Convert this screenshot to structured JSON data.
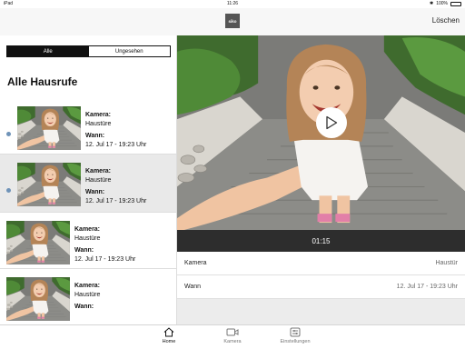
{
  "status_bar": {
    "device": "iPad",
    "time": "11:26",
    "battery": "100%"
  },
  "nav": {
    "logo_text": "siko",
    "delete_label": "Löschen"
  },
  "filter": {
    "all_label": "Alle",
    "unseen_label": "Ungesehen",
    "selected": "Alle"
  },
  "section_title": "Alle Hausrufe",
  "history_items": [
    {
      "camera_label": "Kamera:",
      "camera_value": "Haustüre",
      "when_label": "Wann:",
      "when_value": "12. Jul 17 - 19:23 Uhr",
      "unseen": true,
      "selected": false
    },
    {
      "camera_label": "Kamera:",
      "camera_value": "Haustüre",
      "when_label": "Wann:",
      "when_value": "12. Jul 17 - 19:23 Uhr",
      "unseen": true,
      "selected": true
    },
    {
      "camera_label": "Kamera:",
      "camera_value": "Haustüre",
      "when_label": "Wann:",
      "when_value": "12. Jul 17 - 19:23 Uhr",
      "unseen": false,
      "selected": false
    },
    {
      "camera_label": "Kamera:",
      "camera_value": "Haustüre",
      "when_label": "Wann:",
      "when_value": "",
      "unseen": false,
      "selected": false
    }
  ],
  "player": {
    "duration": "01:15",
    "icon": "play-icon"
  },
  "details": {
    "camera_key": "Kamera",
    "camera_value": "Haustür",
    "when_key": "Wann",
    "when_value": "12. Jul 17 - 19:23 Uhr"
  },
  "tabs": [
    {
      "label": "Home",
      "icon": "home-icon",
      "active": true
    },
    {
      "label": "Kamera",
      "icon": "camera-icon",
      "active": false
    },
    {
      "label": "Einstellungen",
      "icon": "settings-icon",
      "active": false
    }
  ],
  "colors": {
    "accent_dot": "#6f93b8",
    "segment_active": "#111111",
    "timebar": "#2d2d2d"
  }
}
